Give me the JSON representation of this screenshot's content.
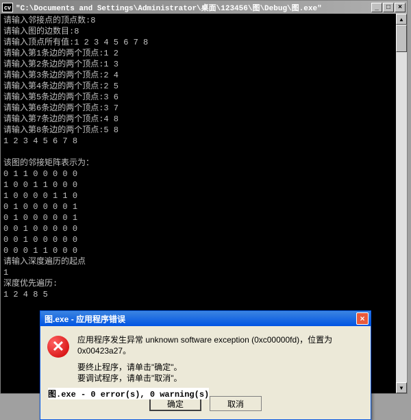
{
  "window": {
    "title": "\"C:\\Documents and Settings\\Administrator\\桌面\\123456\\图\\Debug\\图.exe\"",
    "icon_label": "cv"
  },
  "console": {
    "lines": [
      "请输入邻接点的顶点数:8",
      "请输入图的边数目:8",
      "请输入顶点所有值:1 2 3 4 5 6 7 8",
      "请输入第1条边的两个顶点:1 2",
      "请输入第2条边的两个顶点:1 3",
      "请输入第3条边的两个顶点:2 4",
      "请输入第4条边的两个顶点:2 5",
      "请输入第5条边的两个顶点:3 6",
      "请输入第6条边的两个顶点:3 7",
      "请输入第7条边的两个顶点:4 8",
      "请输入第8条边的两个顶点:5 8",
      "1 2 3 4 5 6 7 8",
      "",
      "该图的邻接矩阵表示为：",
      "0 1 1 0 0 0 0 0",
      "1 0 0 1 1 0 0 0",
      "1 0 0 0 0 1 1 0",
      "0 1 0 0 0 0 0 1",
      "0 1 0 0 0 0 0 1",
      "0 0 1 0 0 0 0 0",
      "0 0 1 0 0 0 0 0",
      "0 0 0 1 1 0 0 0",
      "请输入深度遍历的起点",
      "1",
      "深度优先遍历:",
      "1 2 4 8 5"
    ]
  },
  "dialog": {
    "title": "图.exe - 应用程序错误",
    "message_line1": "应用程序发生异常 unknown software exception (0xc00000fd)，位置为 0x00423a27。",
    "message_line2": "要终止程序，请单击\"确定\"。",
    "message_line3": "要调试程序，请单击\"取消\"。",
    "ok_label": "确定",
    "cancel_label": "取消"
  },
  "bottom": {
    "text": "图.exe - 0 error(s), 0 warning(s)"
  }
}
